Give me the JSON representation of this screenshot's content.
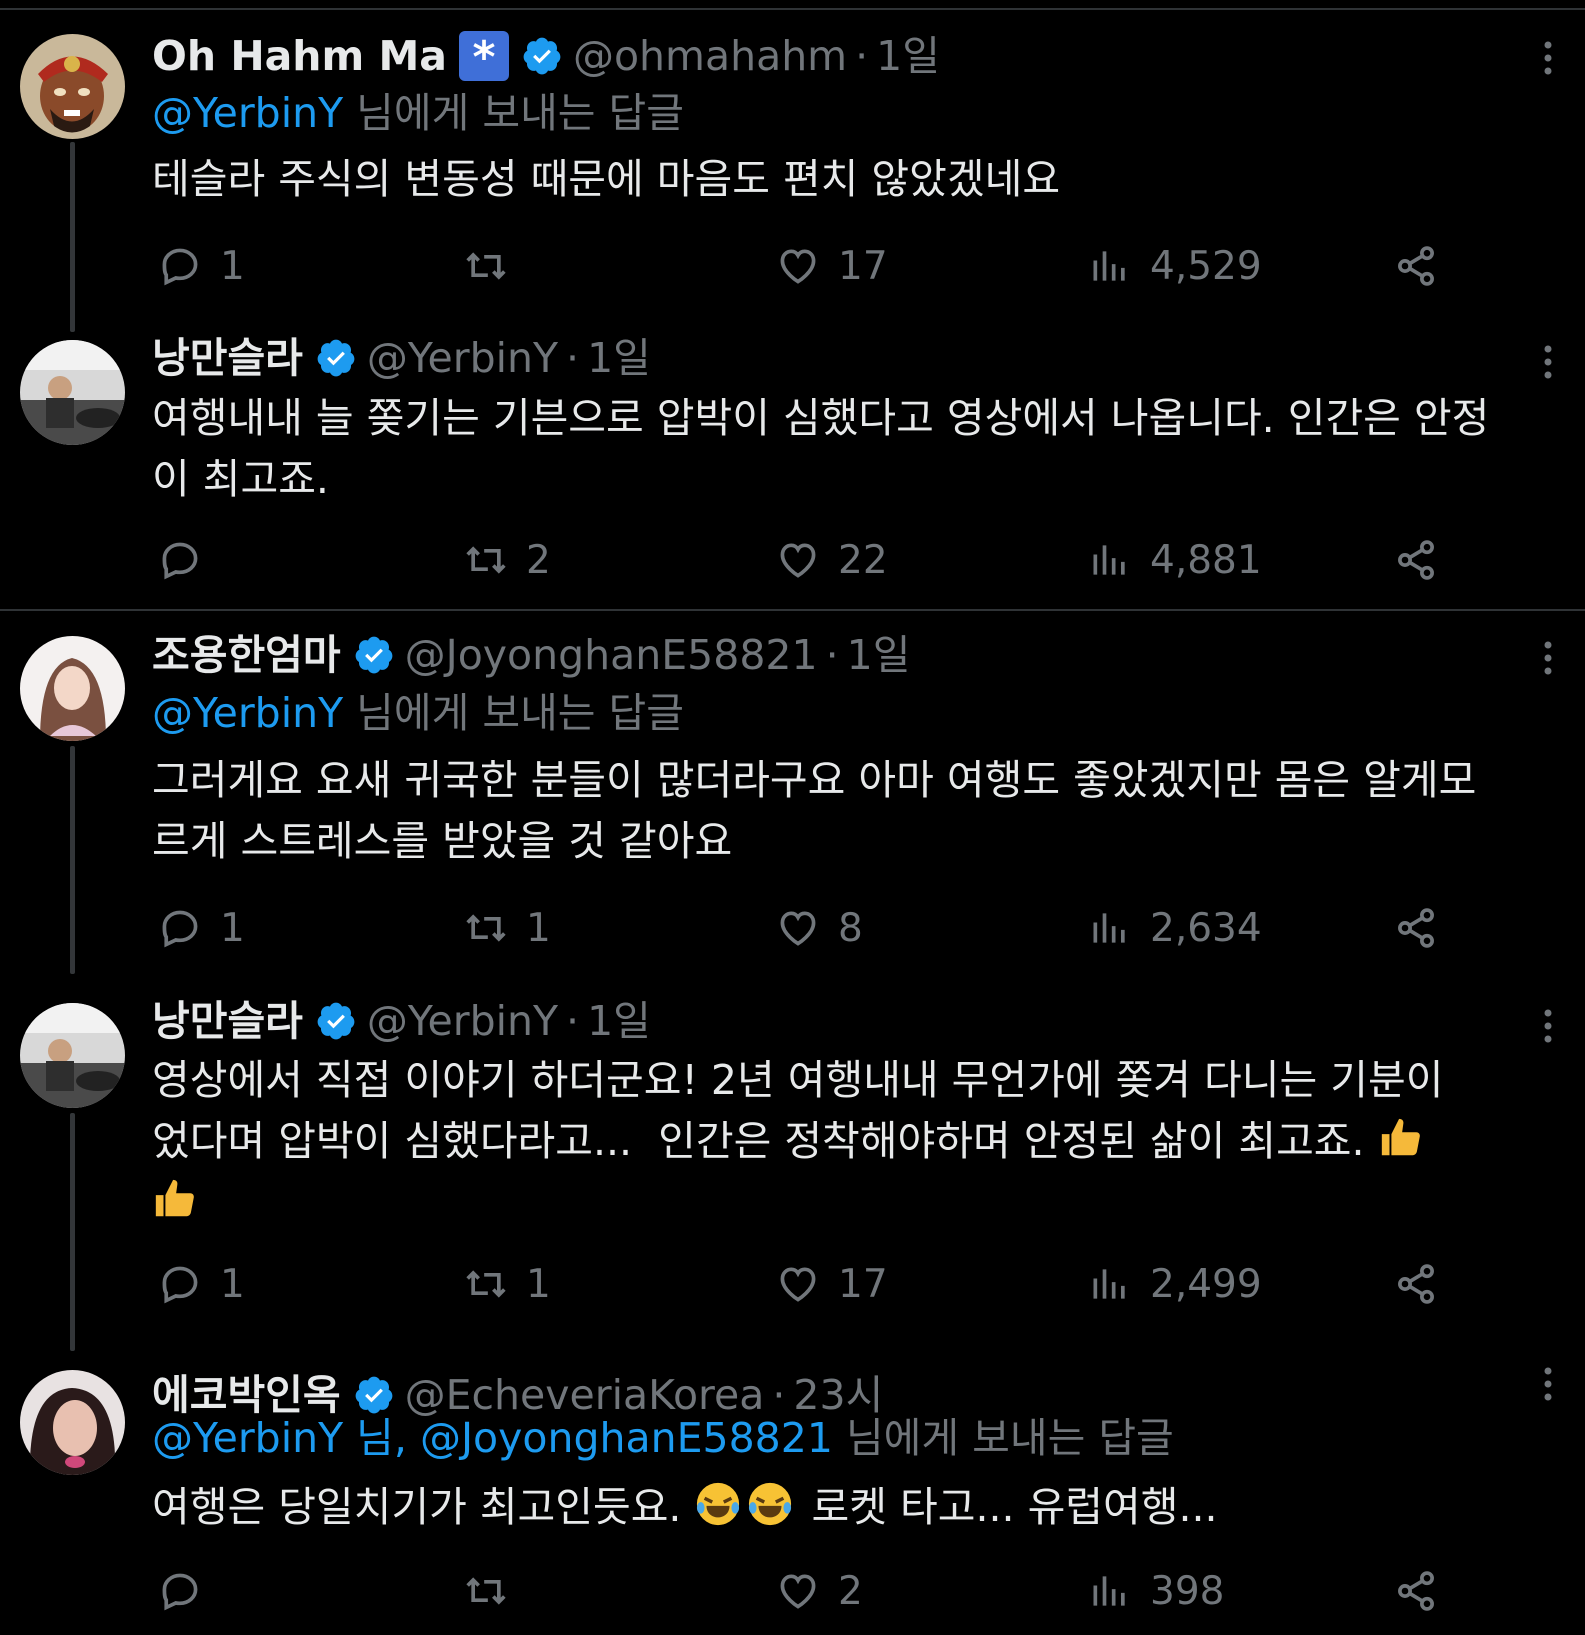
{
  "tweets": [
    {
      "name": "Oh Hahm Ma",
      "handle": "@ohmahahm",
      "dot": "·",
      "time": "1일",
      "square_badge": "*",
      "reply_mentions": "@YerbinY",
      "reply_suffix": " 님에게 보내는 답글",
      "text": "테슬라 주식의 변동성 때문에 마음도 편치 않았겠네요",
      "replies": "1",
      "retweets": "",
      "likes": "17",
      "views": "4,529"
    },
    {
      "name": "낭만슬라",
      "handle": "@YerbinY",
      "dot": "·",
      "time": "1일",
      "text": "여행내내 늘 쫒기는 기븐으로 압박이 심했다고 영상에서 나옵니다. 인간은 안정이 최고죠.",
      "replies": "",
      "retweets": "2",
      "likes": "22",
      "views": "4,881"
    },
    {
      "name": "조용한엄마",
      "handle": "@JoyonghanE58821",
      "dot": "·",
      "time": "1일",
      "reply_mentions": "@YerbinY",
      "reply_suffix": " 님에게 보내는 답글",
      "text": "그러게요 요새 귀국한 분들이 많더라구요 아마 여행도 좋았겠지만 몸은 알게모르게 스트레스를 받았을 것 같아요",
      "replies": "1",
      "retweets": "1",
      "likes": "8",
      "views": "2,634"
    },
    {
      "name": "낭만슬라",
      "handle": "@YerbinY",
      "dot": "·",
      "time": "1일",
      "text": "영상에서 직접 이야기 하더군요! 2년 여행내내 무언가에 쫒겨 다니는 기분이었다며 압박이 심했다라고...  인간은 정착해야하며 안정된 삶이 최고죠.",
      "emoji_name": "thumbs-up",
      "replies": "1",
      "retweets": "1",
      "likes": "17",
      "views": "2,499"
    },
    {
      "name": "에코박인옥",
      "handle": "@EcheveriaKorea",
      "dot": "·",
      "time": "23시",
      "reply_mentions": "@YerbinY 님, @JoyonghanE58821",
      "reply_suffix": " 님에게 보내는 답글",
      "text_before": "여행은 당일치기가 최고인듯요. ",
      "text_after": " 로켓 타고... 유럽여행...",
      "emoji_name": "rolling-on-floor-laughing",
      "replies": "",
      "retweets": "",
      "likes": "2",
      "views": "398"
    }
  ],
  "colors": {
    "background": "#000000",
    "text": "#e7e9ea",
    "muted": "#71767b",
    "accent": "#1d9bf0",
    "verified": "#1d9bf0",
    "divider": "#2f3336"
  }
}
